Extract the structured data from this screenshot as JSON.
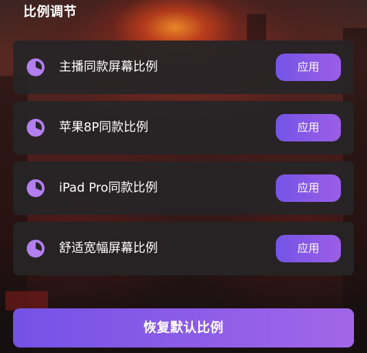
{
  "section": {
    "title": "比例调节"
  },
  "presets": [
    {
      "label": "主播同款屏幕比例",
      "icon": "pie-chart-icon",
      "button_label": "应用"
    },
    {
      "label": "苹果8P同款比例",
      "icon": "pie-chart-icon",
      "button_label": "应用"
    },
    {
      "label": "iPad Pro同款比例",
      "icon": "pie-chart-icon",
      "button_label": "应用"
    },
    {
      "label": "舒适宽幅屏幕比例",
      "icon": "pie-chart-icon",
      "button_label": "应用"
    }
  ],
  "restore_button": {
    "label": "恢复默认比例"
  },
  "colors": {
    "accent_start": "#7454e6",
    "accent_end": "#9c5ee6",
    "icon": "#b27ef0",
    "card_background": "#262426"
  }
}
